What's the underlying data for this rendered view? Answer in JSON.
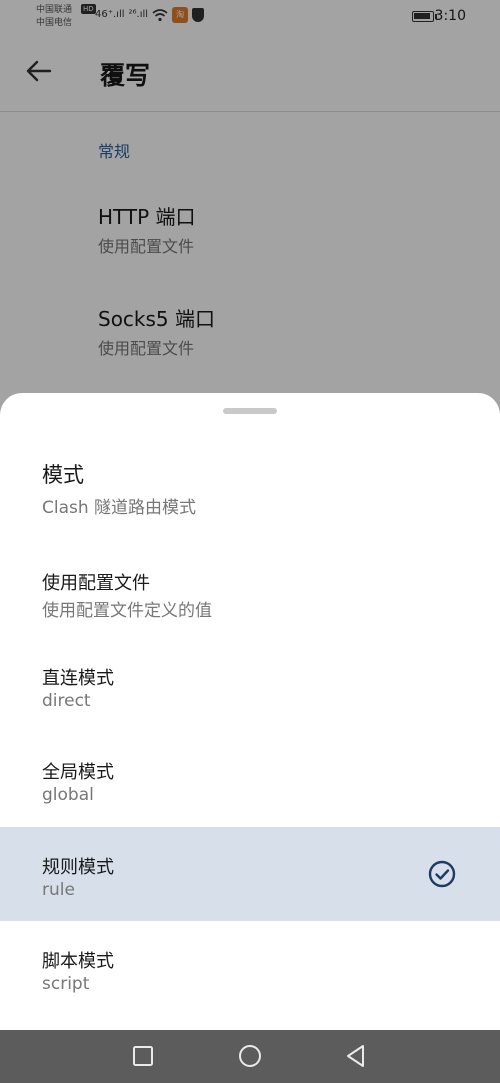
{
  "status_bar": {
    "carrier_1": "中国联通",
    "carrier_2": "中国电信",
    "hd_label": "HD",
    "signal_1": "46⁺.ıll",
    "signal_2": "²⁶.ıll",
    "app_badge": "淘",
    "time": "3:10"
  },
  "topbar": {
    "title": "覆写"
  },
  "background": {
    "section_label": "常规",
    "settings": [
      {
        "title": "HTTP 端口",
        "subtitle": "使用配置文件"
      },
      {
        "title": "Socks5 端口",
        "subtitle": "使用配置文件"
      }
    ]
  },
  "sheet": {
    "title": "模式",
    "subtitle": "Clash 隧道路由模式",
    "options": [
      {
        "title": "使用配置文件",
        "subtitle": "使用配置文件定义的值",
        "selected": false
      },
      {
        "title": "直连模式",
        "subtitle": "direct",
        "selected": false
      },
      {
        "title": "全局模式",
        "subtitle": "global",
        "selected": false
      },
      {
        "title": "规则模式",
        "subtitle": "rule",
        "selected": true
      },
      {
        "title": "脚本模式",
        "subtitle": "script",
        "selected": false
      }
    ]
  },
  "colors": {
    "accent": "#2b5f9e",
    "selected_bg": "#d7dfeb",
    "check": "#1f3a63",
    "nav_bg": "#5c5c5c"
  }
}
